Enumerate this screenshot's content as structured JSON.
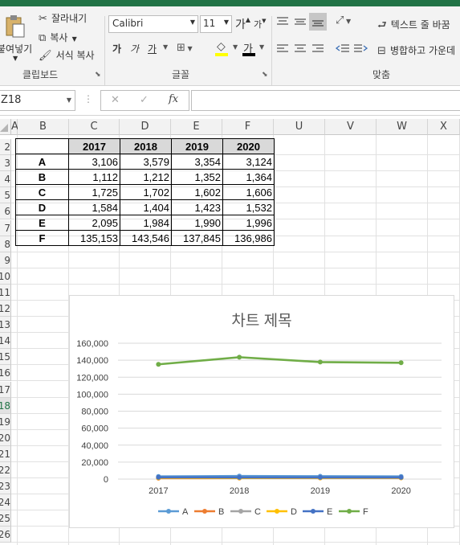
{
  "ribbon": {
    "paste_label": "붙여넣기",
    "cut_label": "잘라내기",
    "copy_label": "복사",
    "format_painter_label": "서식 복사",
    "clipboard_group": "클립보드",
    "font_name": "Calibri",
    "font_size": "11",
    "font_group": "글꼴",
    "wrap_text_label": "텍스트 줄 바꿈",
    "merge_center_label": "병합하고 가운데",
    "align_group": "맞춤",
    "grow_font": "가",
    "shrink_font": "가",
    "bold": "가",
    "italic": "가",
    "underline": "가",
    "font_color_glyph": "가",
    "fill_glyph": "◇"
  },
  "formula_bar": {
    "name_box": "Z18",
    "fx": "fx",
    "cancel": "✕",
    "enter": "✓",
    "formula": ""
  },
  "columns": [
    "A",
    "B",
    "C",
    "D",
    "E",
    "F",
    "U",
    "V",
    "W",
    "X"
  ],
  "rows": [
    "2",
    "3",
    "4",
    "5",
    "6",
    "7",
    "8",
    "9",
    "10",
    "11",
    "12",
    "13",
    "14",
    "15",
    "16",
    "17",
    "18",
    "19",
    "20",
    "21",
    "22",
    "23",
    "24",
    "25",
    "26"
  ],
  "table": {
    "header": [
      "2017",
      "2018",
      "2019",
      "2020"
    ],
    "rows": [
      {
        "label": "A",
        "values": [
          "3,106",
          "3,579",
          "3,354",
          "3,124"
        ]
      },
      {
        "label": "B",
        "values": [
          "1,112",
          "1,212",
          "1,352",
          "1,364"
        ]
      },
      {
        "label": "C",
        "values": [
          "1,725",
          "1,702",
          "1,602",
          "1,606"
        ]
      },
      {
        "label": "D",
        "values": [
          "1,584",
          "1,404",
          "1,423",
          "1,532"
        ]
      },
      {
        "label": "E",
        "values": [
          "2,095",
          "1,984",
          "1,990",
          "1,996"
        ]
      },
      {
        "label": "F",
        "values": [
          "135,153",
          "143,546",
          "137,845",
          "136,986"
        ]
      }
    ]
  },
  "chart_data": {
    "type": "line",
    "title": "차트 제목",
    "categories": [
      "2017",
      "2018",
      "2019",
      "2020"
    ],
    "ylim": [
      0,
      160000
    ],
    "yticks": [
      "0",
      "20,000",
      "40,000",
      "60,000",
      "80,000",
      "100,000",
      "120,000",
      "140,000",
      "160,000"
    ],
    "grid": true,
    "legend": "bottom",
    "series": [
      {
        "name": "A",
        "values": [
          3106,
          3579,
          3354,
          3124
        ],
        "color": "#5b9bd5"
      },
      {
        "name": "B",
        "values": [
          1112,
          1212,
          1352,
          1364
        ],
        "color": "#ed7d31"
      },
      {
        "name": "C",
        "values": [
          1725,
          1702,
          1602,
          1606
        ],
        "color": "#a5a5a5"
      },
      {
        "name": "D",
        "values": [
          1584,
          1404,
          1423,
          1532
        ],
        "color": "#ffc000"
      },
      {
        "name": "E",
        "values": [
          2095,
          1984,
          1990,
          1996
        ],
        "color": "#4472c4"
      },
      {
        "name": "F",
        "values": [
          135153,
          143546,
          137845,
          136986
        ],
        "color": "#70ad47"
      }
    ]
  }
}
